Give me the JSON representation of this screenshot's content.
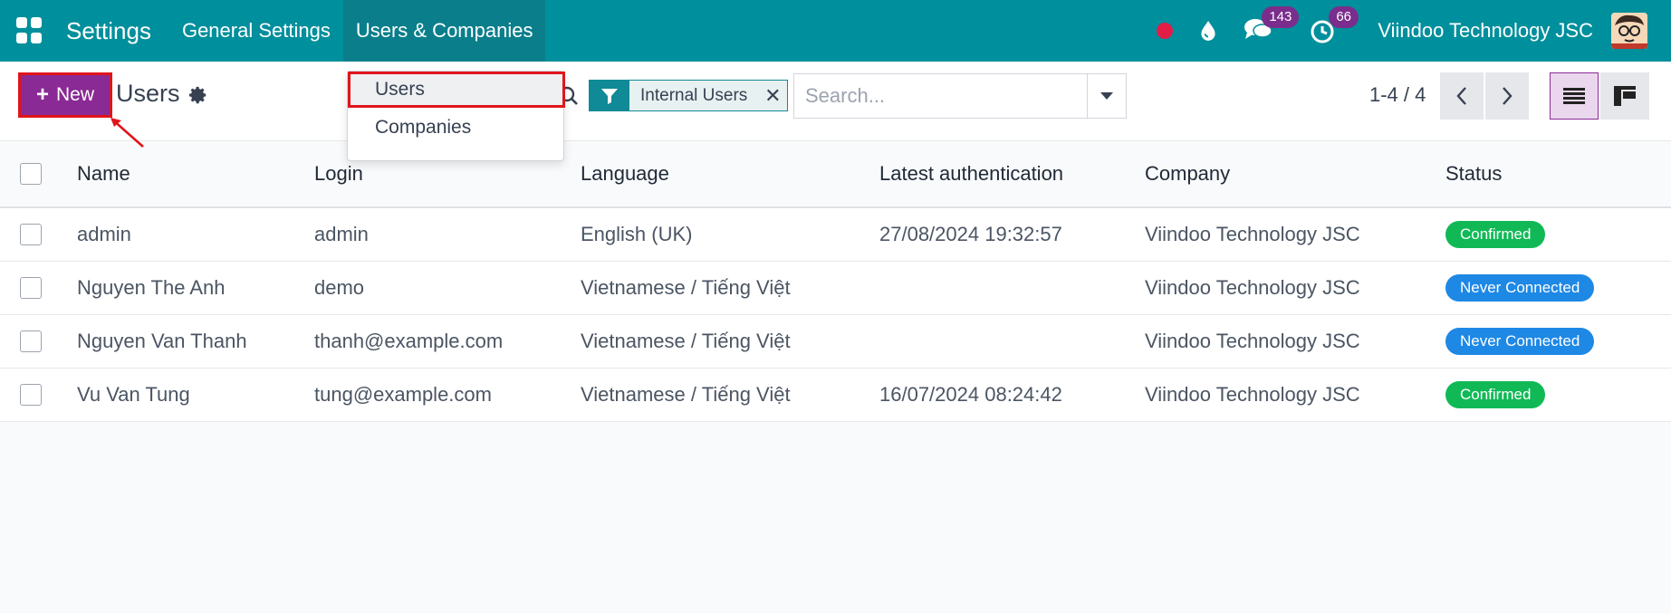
{
  "topbar": {
    "app_title": "Settings",
    "nav": [
      "General Settings",
      "Users & Companies"
    ],
    "messages_count": "143",
    "activities_count": "66",
    "company": "Viindoo Technology JSC"
  },
  "control": {
    "new_label": "New",
    "breadcrumb": "Users",
    "filter_facet": "Internal Users",
    "search_placeholder": "Search...",
    "pager": "1-4 / 4"
  },
  "dropdown": {
    "items": [
      "Users",
      "Companies"
    ]
  },
  "table": {
    "headers": [
      "Name",
      "Login",
      "Language",
      "Latest authentication",
      "Company",
      "Status"
    ],
    "rows": [
      {
        "name": "admin",
        "login": "admin",
        "language": "English (UK)",
        "auth": "27/08/2024 19:32:57",
        "company": "Viindoo Technology JSC",
        "status": "Confirmed",
        "status_color": "#10b956"
      },
      {
        "name": "Nguyen The Anh",
        "login": "demo",
        "language": "Vietnamese / Tiếng Việt",
        "auth": "",
        "company": "Viindoo Technology JSC",
        "status": "Never Connected",
        "status_color": "#1e88e5"
      },
      {
        "name": "Nguyen Van Thanh",
        "login": "thanh@example.com",
        "language": "Vietnamese / Tiếng Việt",
        "auth": "",
        "company": "Viindoo Technology JSC",
        "status": "Never Connected",
        "status_color": "#1e88e5"
      },
      {
        "name": "Vu Van Tung",
        "login": "tung@example.com",
        "language": "Vietnamese / Tiếng Việt",
        "auth": "16/07/2024 08:24:42",
        "company": "Viindoo Technology JSC",
        "status": "Confirmed",
        "status_color": "#10b956"
      }
    ]
  },
  "colors": {
    "topbar": "#008f9c",
    "primary": "#8a2a94",
    "highlight_border": "#e0151b"
  },
  "icons": [
    "apps-icon",
    "record-icon",
    "drop-icon",
    "chat-icon",
    "clock-icon",
    "gear-icon",
    "search-icon",
    "filter-icon",
    "close-icon",
    "chevron-left-icon",
    "chevron-right-icon",
    "list-view-icon",
    "kanban-view-icon"
  ]
}
